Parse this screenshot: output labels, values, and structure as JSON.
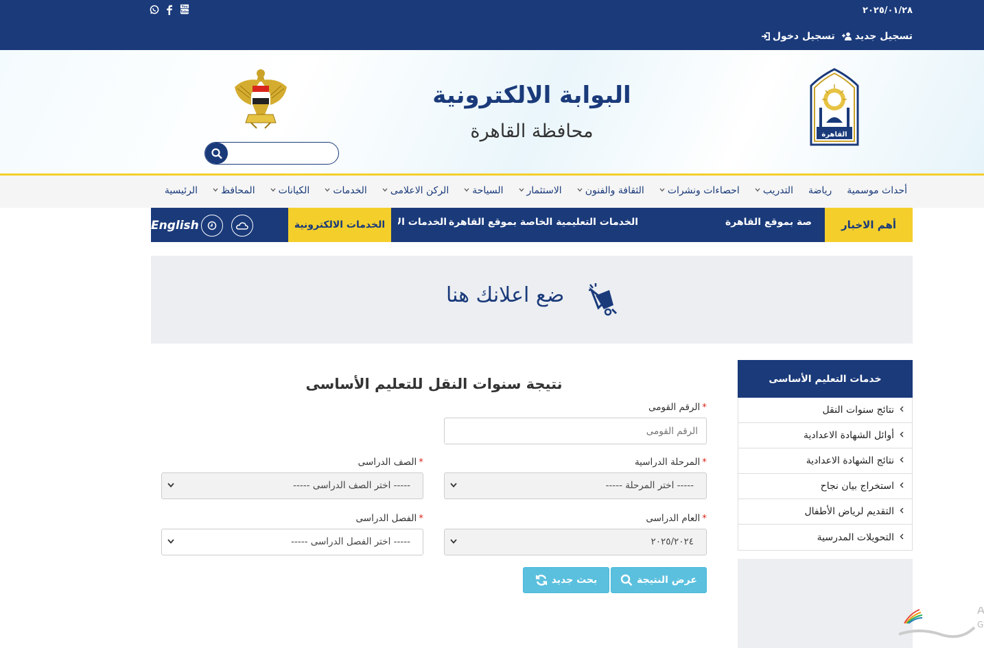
{
  "topbar": {
    "date": "٢٠٢٥/٠١/٢٨",
    "login": "تسجيل دخول",
    "register": "تسجيل جديد",
    "social": [
      "youtube-icon",
      "facebook-icon",
      "whatsapp-icon"
    ]
  },
  "header": {
    "title": "البوابة الالكترونية",
    "subtitle": "محافظة القاهرة",
    "search_placeholder": ""
  },
  "mainnav": {
    "items": [
      {
        "label": "الرئيسية",
        "dropdown": false
      },
      {
        "label": "المحافظ",
        "dropdown": true
      },
      {
        "label": "الكيانات",
        "dropdown": true
      },
      {
        "label": "الخدمات",
        "dropdown": true
      },
      {
        "label": "الركن الاعلامى",
        "dropdown": true
      },
      {
        "label": "السياحة",
        "dropdown": true
      },
      {
        "label": "الاستثمار",
        "dropdown": true
      },
      {
        "label": "الثقافة والفنون",
        "dropdown": true
      },
      {
        "label": "احصاءات ونشرات",
        "dropdown": true
      },
      {
        "label": "التدريب",
        "dropdown": true
      },
      {
        "label": "رياضة",
        "dropdown": false
      },
      {
        "label": "أحداث موسمية",
        "dropdown": false
      }
    ]
  },
  "subnav": {
    "news_label": "أهم الاخبار",
    "ticker": [
      "صة بموقع القاهرة",
      "الخدمات التعليمية الخاصة بموقع القاهرة",
      "الخدمات الا"
    ],
    "eservices": "الخدمات الالكترونية",
    "english": "English"
  },
  "ad": {
    "text": "ضع اعلانك هنا"
  },
  "sidebar": {
    "title": "خدمات التعليم الأساسى",
    "items": [
      "نتائج سنوات النقل",
      "أوائل الشهادة الاعدادية",
      "نتائج الشهادة الاعدادية",
      "استخراج بيان نجاح",
      "التقديم لرياض الأطفال",
      "التحويلات المدرسية"
    ]
  },
  "form": {
    "title": "نتيجة سنوات النقل للتعليم الأساسى",
    "national_id_label": "الرقم القومى",
    "national_id_placeholder": "الرقم القومى",
    "stage_label": "المرحلة الدراسية",
    "stage_value": "----- اختر المرحلة -----",
    "grade_label": "الصف الدراسى",
    "grade_value": "----- اختر الصف الدراسى -----",
    "year_label": "العام الدراسى",
    "year_value": "٢٠٢٥/٢٠٢٤",
    "term_label": "الفصل الدراسى",
    "term_value": "----- اختر الفصل الدراسى -----",
    "show_result": "عرض النتيجة",
    "new_search": "بحث جديد",
    "required_mark": "*"
  },
  "colors": {
    "primary": "#1a3a7a",
    "accent": "#f4cf2b",
    "button": "#5bc0de",
    "required": "#d9261c"
  }
}
